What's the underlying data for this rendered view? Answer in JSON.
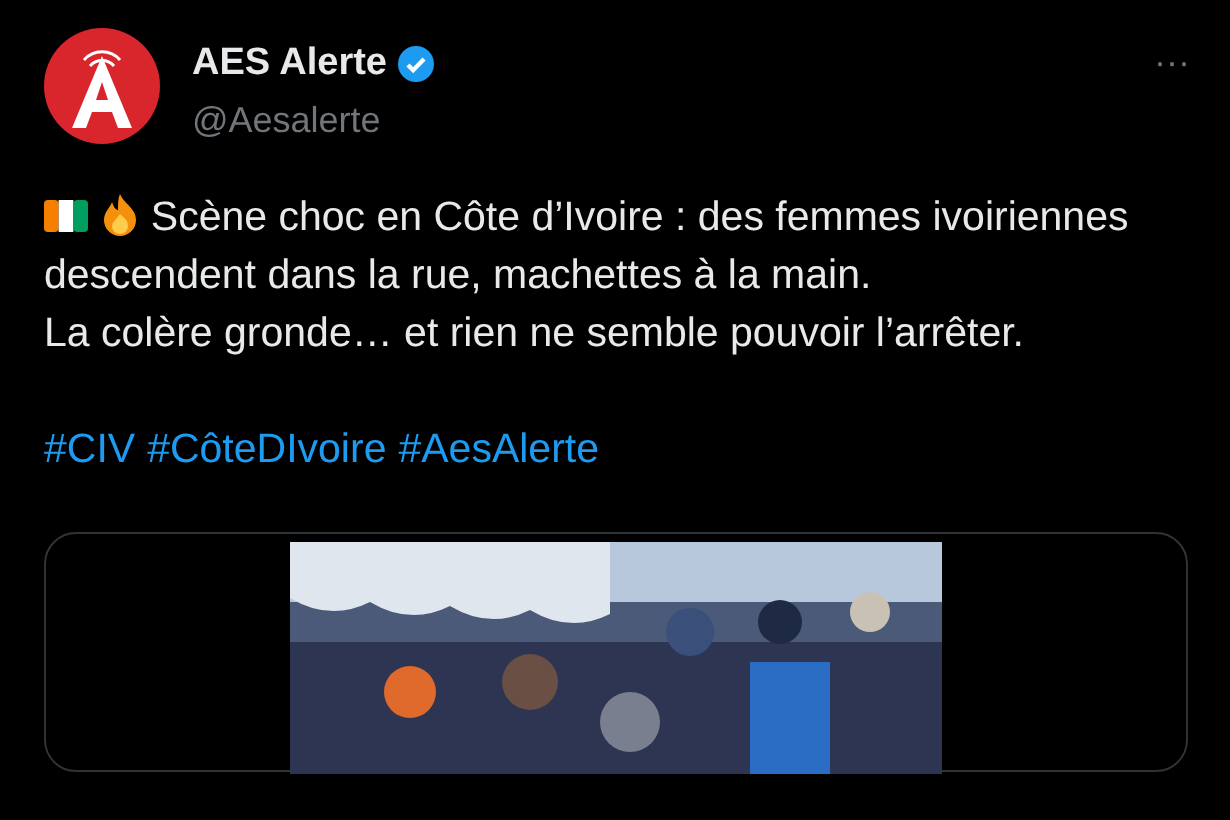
{
  "post": {
    "author": "AES Alerte",
    "verified": true,
    "handle": "@Aesalerte",
    "more": "···",
    "lines": [
      "Scène choc en Côte d’Ivoire : des femmes ivoiriennes descendent dans la rue, machettes à la main.",
      "La colère gronde… et rien ne semble pouvoir l’arrêter."
    ],
    "hashtags": [
      "#CIV",
      "#CôteDIvoire",
      "#AesAlerte"
    ],
    "media": {
      "kind": "picture"
    }
  }
}
